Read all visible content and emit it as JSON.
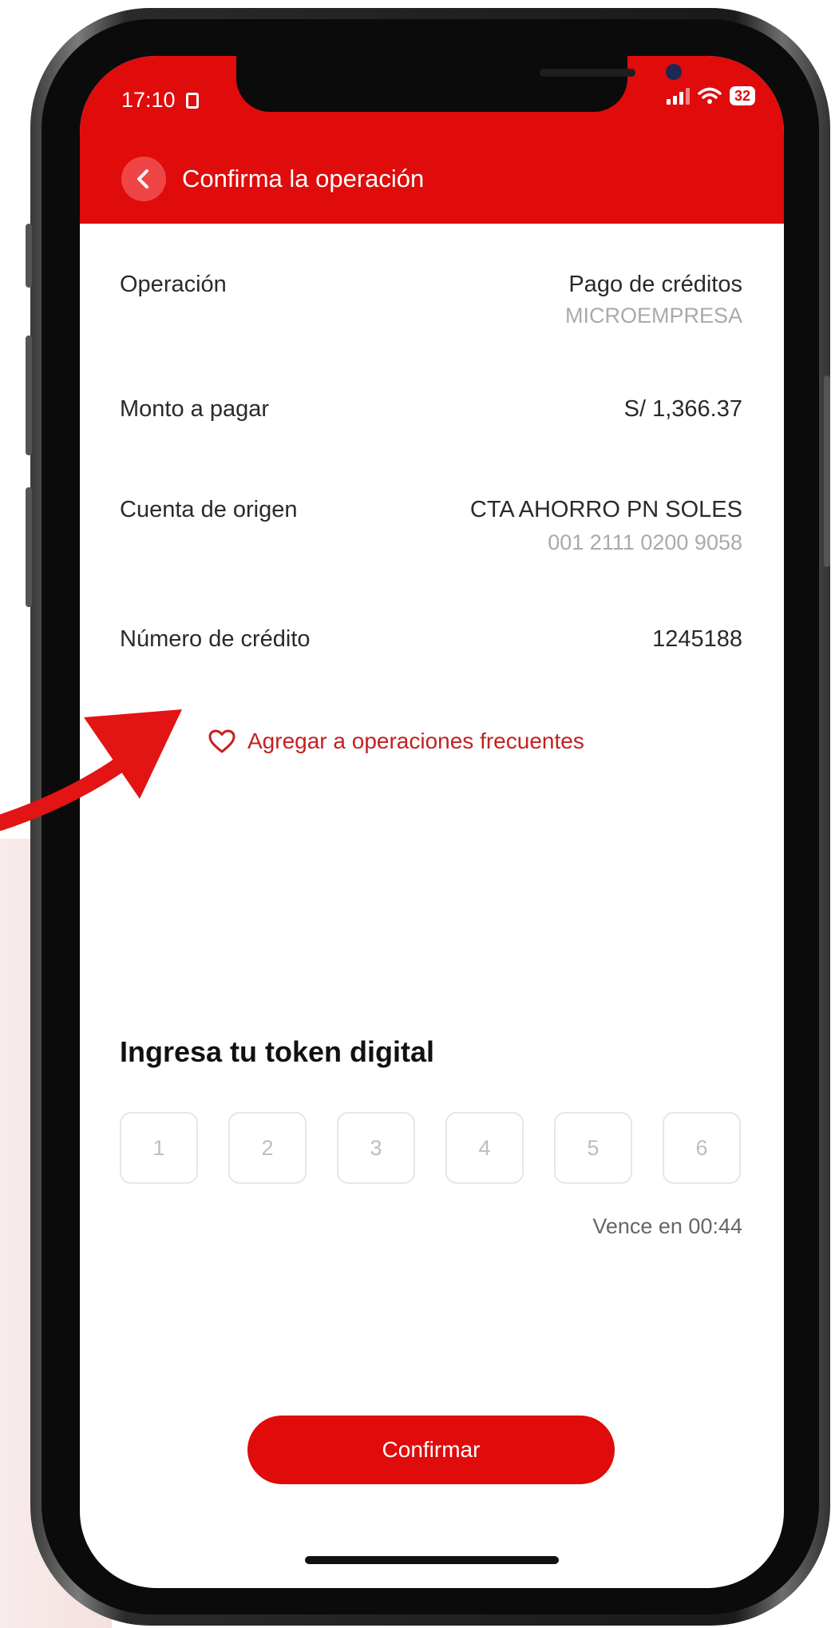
{
  "status": {
    "time": "17:10",
    "battery": "32"
  },
  "header": {
    "title": "Confirma la operación"
  },
  "details": {
    "operation_label": "Operación",
    "operation_value": "Pago de créditos",
    "operation_sub": "MICROEMPRESA",
    "amount_label": "Monto a pagar",
    "amount_value": "S/ 1,366.37",
    "account_label": "Cuenta de origen",
    "account_value": "CTA AHORRO PN SOLES",
    "account_number": "001 2111 0200 9058",
    "credit_label": "Número de crédito",
    "credit_value": "1245188"
  },
  "favorite": {
    "label": "Agregar a operaciones frecuentes"
  },
  "token": {
    "title": "Ingresa tu token digital",
    "placeholders": [
      "1",
      "2",
      "3",
      "4",
      "5",
      "6"
    ],
    "expiry": "Vence en 00:44"
  },
  "actions": {
    "confirm_label": "Confirmar"
  },
  "colors": {
    "brand": "#e00b0b",
    "favorite": "#c42020",
    "annotation_arrow": "#e31414"
  }
}
